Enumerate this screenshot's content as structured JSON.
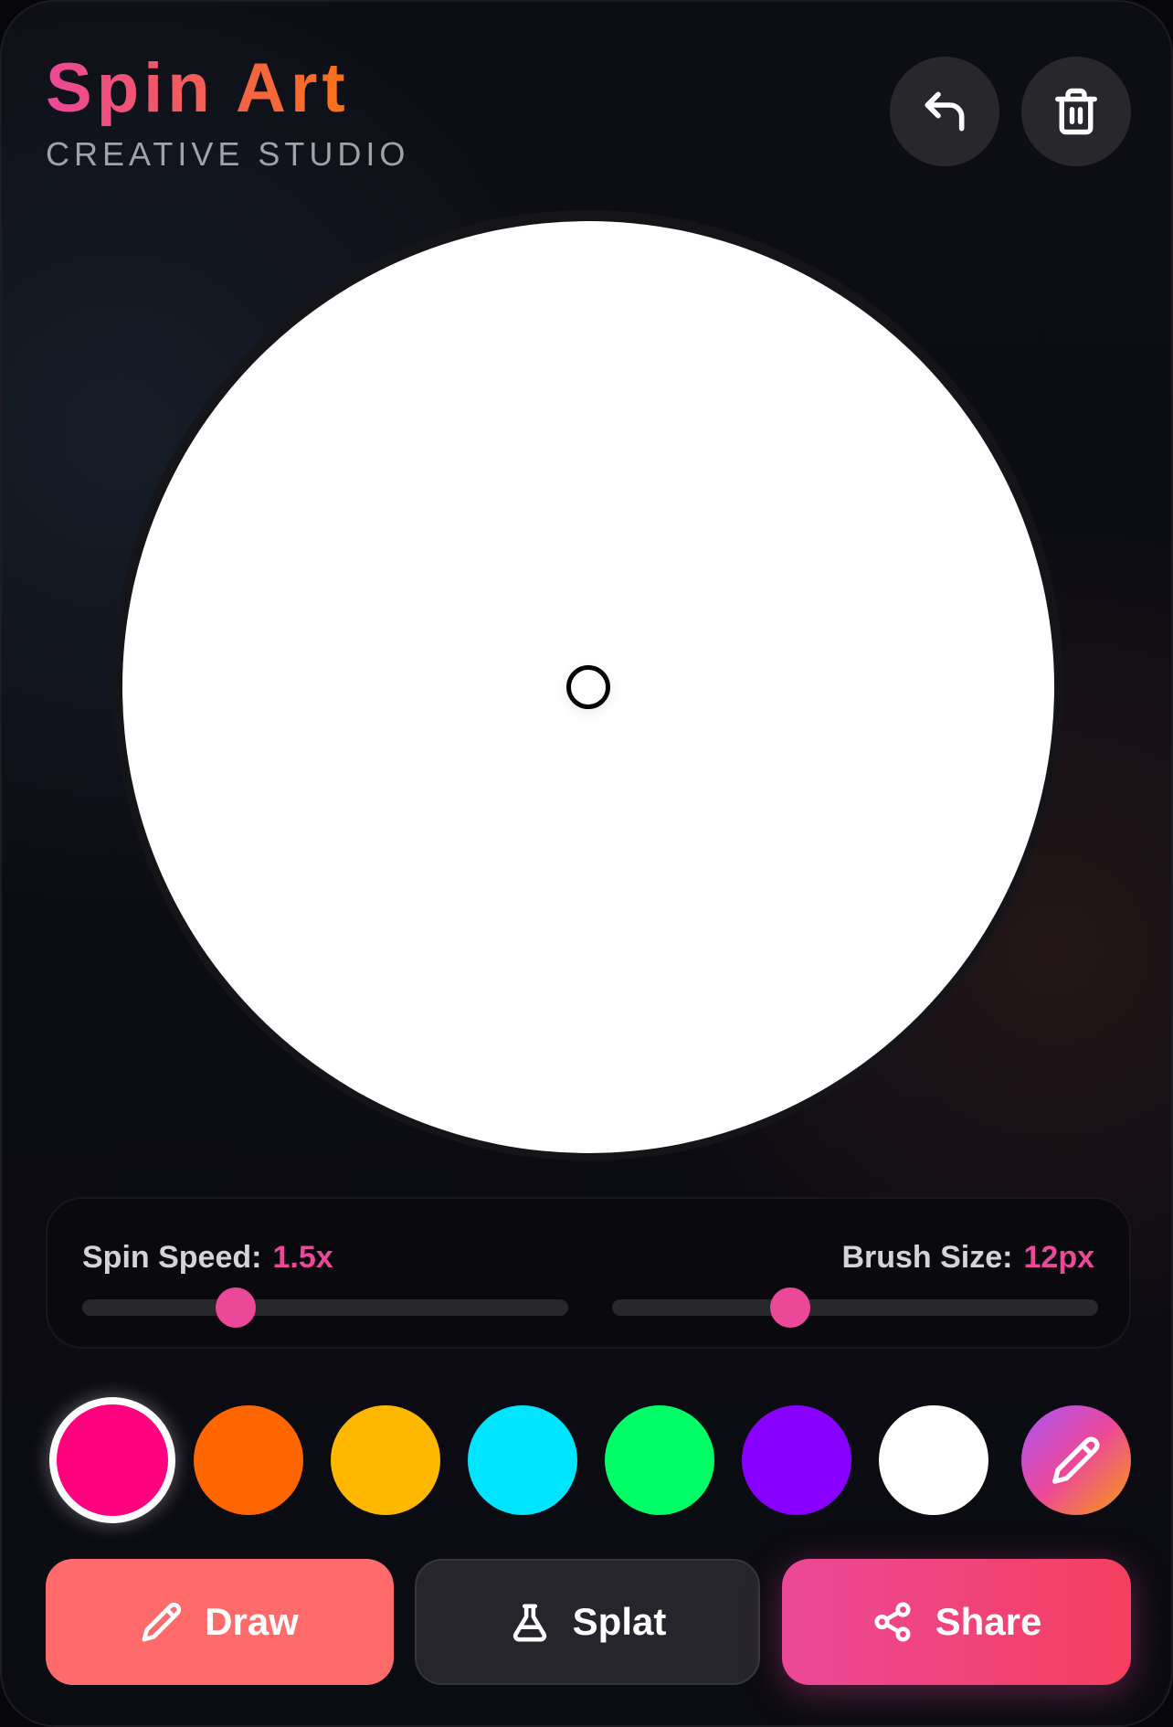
{
  "header": {
    "title": "Spin Art",
    "subtitle": "CREATIVE STUDIO",
    "undo_icon": "undo-arrow-icon",
    "trash_icon": "trash-icon"
  },
  "canvas": {
    "background": "#ffffff",
    "center_marker": "spindle-dot"
  },
  "controls": {
    "spin_speed": {
      "label": "Spin Speed:",
      "value": "1.5x",
      "fraction": 0.315
    },
    "brush_size": {
      "label": "Brush Size:",
      "value": "12px",
      "fraction": 0.367
    },
    "accent_color": "#ec4899"
  },
  "palette": {
    "colors": [
      "#ff007f",
      "#ff6600",
      "#ffb800",
      "#00e5ff",
      "#00ff66",
      "#8800ff",
      "#ffffff"
    ],
    "selected_index": 0,
    "custom_icon": "pencil-icon"
  },
  "actions": {
    "draw_label": "Draw",
    "splat_label": "Splat",
    "share_label": "Share",
    "draw_icon": "pencil-icon",
    "splat_icon": "flask-icon",
    "share_icon": "share-icon"
  }
}
